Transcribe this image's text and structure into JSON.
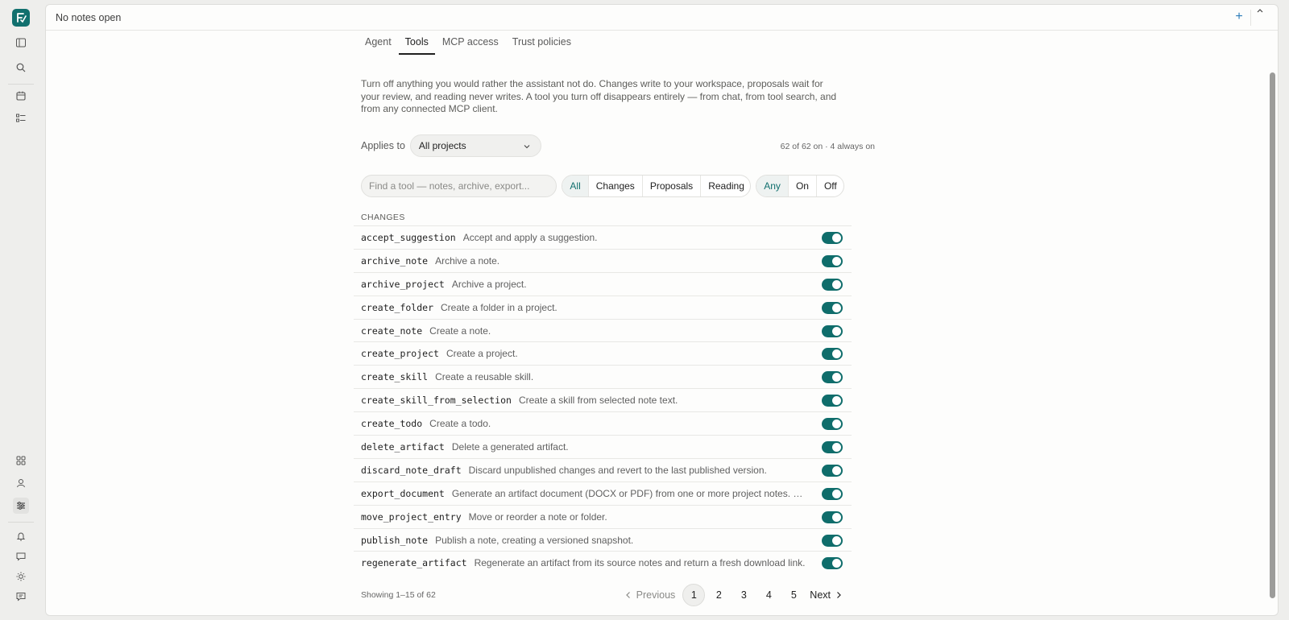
{
  "topbar": {
    "title": "No notes open",
    "plus": "+"
  },
  "tabs": [
    {
      "label": "Agent",
      "active": false
    },
    {
      "label": "Tools",
      "active": true
    },
    {
      "label": "MCP access",
      "active": false
    },
    {
      "label": "Trust policies",
      "active": false
    }
  ],
  "intro": "Turn off anything you would rather the assistant not do. Changes write to your workspace, proposals wait for your review, and reading never writes. A tool you turn off disappears entirely — from chat, from tool search, and from any connected MCP client.",
  "applies": {
    "label": "Applies to",
    "selected": "All projects"
  },
  "counts": "62 of 62 on · 4 always on",
  "search": {
    "placeholder": "Find a tool — notes, archive, export..."
  },
  "kind_filter": [
    {
      "label": "All",
      "active": true
    },
    {
      "label": "Changes",
      "active": false
    },
    {
      "label": "Proposals",
      "active": false
    },
    {
      "label": "Reading",
      "active": false
    }
  ],
  "state_filter": [
    {
      "label": "Any",
      "active": true
    },
    {
      "label": "On",
      "active": false
    },
    {
      "label": "Off",
      "active": false
    }
  ],
  "section": "CHANGES",
  "tools": [
    {
      "name": "accept_suggestion",
      "desc": "Accept and apply a suggestion.",
      "on": true
    },
    {
      "name": "archive_note",
      "desc": "Archive a note.",
      "on": true
    },
    {
      "name": "archive_project",
      "desc": "Archive a project.",
      "on": true
    },
    {
      "name": "create_folder",
      "desc": "Create a folder in a project.",
      "on": true
    },
    {
      "name": "create_note",
      "desc": "Create a note.",
      "on": true
    },
    {
      "name": "create_project",
      "desc": "Create a project.",
      "on": true
    },
    {
      "name": "create_skill",
      "desc": "Create a reusable skill.",
      "on": true
    },
    {
      "name": "create_skill_from_selection",
      "desc": "Create a skill from selected note text.",
      "on": true
    },
    {
      "name": "create_todo",
      "desc": "Create a todo.",
      "on": true
    },
    {
      "name": "delete_artifact",
      "desc": "Delete a generated artifact.",
      "on": true
    },
    {
      "name": "discard_note_draft",
      "desc": "Discard unpublished changes and revert to the last published version.",
      "on": true
    },
    {
      "name": "export_document",
      "desc": "Generate an artifact document (DOCX or PDF) from one or more project notes. Option...",
      "on": true
    },
    {
      "name": "move_project_entry",
      "desc": "Move or reorder a note or folder.",
      "on": true
    },
    {
      "name": "publish_note",
      "desc": "Publish a note, creating a versioned snapshot.",
      "on": true
    },
    {
      "name": "regenerate_artifact",
      "desc": "Regenerate an artifact from its source notes and return a fresh download link.",
      "on": true
    }
  ],
  "pagination": {
    "showing": "Showing 1–15 of 62",
    "previous": "Previous",
    "next": "Next",
    "pages": [
      "1",
      "2",
      "3",
      "4",
      "5"
    ],
    "current": "1"
  },
  "colors": {
    "accent": "#11706e",
    "toggle_on": "#0f6d6b"
  }
}
